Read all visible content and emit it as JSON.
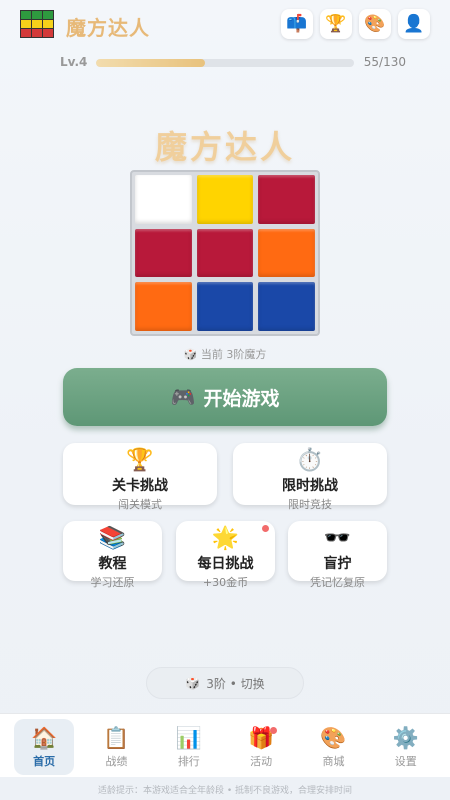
{
  "header": {
    "app_title": "魔方达人",
    "logo_colors": [
      "#2e9a3f",
      "#2e9a3f",
      "#2e9a3f",
      "#f5d21a",
      "#f5d21a",
      "#f5d21a",
      "#d33a3a",
      "#d33a3a",
      "#d33a3a"
    ],
    "icons": [
      {
        "name": "mailbox-icon",
        "glyph": "📫"
      },
      {
        "name": "trophy-icon",
        "glyph": "🏆"
      },
      {
        "name": "palette-icon",
        "glyph": "🎨"
      },
      {
        "name": "user-icon",
        "glyph": "👤"
      }
    ]
  },
  "level": {
    "label": "Lv.4",
    "current": 55,
    "max": 130,
    "count_text": "55/130"
  },
  "main_title": "魔方达人",
  "cube": {
    "cells": [
      "#ffffff",
      "#ffd400",
      "#b8193a",
      "#b8193a",
      "#b8193a",
      "#ff6a12",
      "#ff6a12",
      "#1a48a8",
      "#1a48a8"
    ],
    "caption": "🎲 当前 3阶魔方"
  },
  "start": {
    "icon": "🎮",
    "label": "开始游戏"
  },
  "cards": {
    "levels": {
      "icon": "🏆",
      "title": "关卡挑战",
      "sub": "闯关模式"
    },
    "timed": {
      "icon": "⏱️",
      "title": "限时挑战",
      "sub": "限时竞技"
    },
    "tutorial": {
      "icon": "📚",
      "title": "教程",
      "sub": "学习还原"
    },
    "daily": {
      "icon": "🌟",
      "title": "每日挑战",
      "sub": "+30金币"
    },
    "blind": {
      "icon": "🕶️",
      "title": "盲拧",
      "sub": "凭记忆复原"
    }
  },
  "switch": {
    "icon": "🎲",
    "label": "3阶 • 切换"
  },
  "tabs": [
    {
      "name": "home",
      "icon": "🏠",
      "label": "首页"
    },
    {
      "name": "records",
      "icon": "📋",
      "label": "战绩"
    },
    {
      "name": "ranking",
      "icon": "📊",
      "label": "排行"
    },
    {
      "name": "events",
      "icon": "🎁",
      "label": "活动"
    },
    {
      "name": "shop",
      "icon": "🎨",
      "label": "商城"
    },
    {
      "name": "settings",
      "icon": "⚙️",
      "label": "设置"
    }
  ],
  "footer_note": "适龄提示：本游戏适合全年龄段 • 抵制不良游戏，合理安排时间"
}
